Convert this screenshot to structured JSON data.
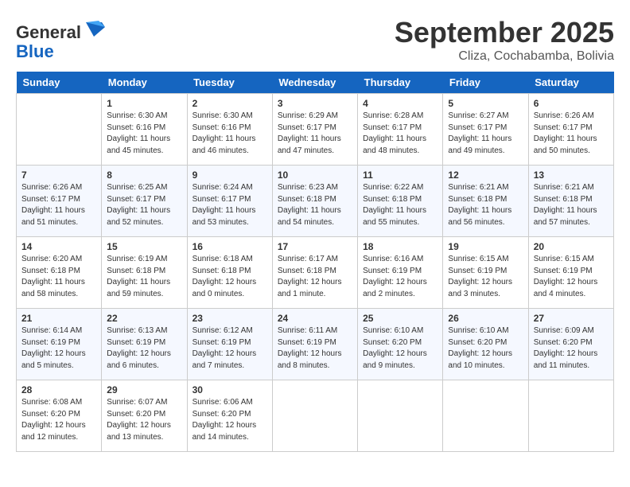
{
  "header": {
    "logo_general": "General",
    "logo_blue": "Blue",
    "month": "September 2025",
    "location": "Cliza, Cochabamba, Bolivia"
  },
  "columns": [
    "Sunday",
    "Monday",
    "Tuesday",
    "Wednesday",
    "Thursday",
    "Friday",
    "Saturday"
  ],
  "weeks": [
    [
      {
        "day": "",
        "info": ""
      },
      {
        "day": "1",
        "info": "Sunrise: 6:30 AM\nSunset: 6:16 PM\nDaylight: 11 hours\nand 45 minutes."
      },
      {
        "day": "2",
        "info": "Sunrise: 6:30 AM\nSunset: 6:16 PM\nDaylight: 11 hours\nand 46 minutes."
      },
      {
        "day": "3",
        "info": "Sunrise: 6:29 AM\nSunset: 6:17 PM\nDaylight: 11 hours\nand 47 minutes."
      },
      {
        "day": "4",
        "info": "Sunrise: 6:28 AM\nSunset: 6:17 PM\nDaylight: 11 hours\nand 48 minutes."
      },
      {
        "day": "5",
        "info": "Sunrise: 6:27 AM\nSunset: 6:17 PM\nDaylight: 11 hours\nand 49 minutes."
      },
      {
        "day": "6",
        "info": "Sunrise: 6:26 AM\nSunset: 6:17 PM\nDaylight: 11 hours\nand 50 minutes."
      }
    ],
    [
      {
        "day": "7",
        "info": "Sunrise: 6:26 AM\nSunset: 6:17 PM\nDaylight: 11 hours\nand 51 minutes."
      },
      {
        "day": "8",
        "info": "Sunrise: 6:25 AM\nSunset: 6:17 PM\nDaylight: 11 hours\nand 52 minutes."
      },
      {
        "day": "9",
        "info": "Sunrise: 6:24 AM\nSunset: 6:17 PM\nDaylight: 11 hours\nand 53 minutes."
      },
      {
        "day": "10",
        "info": "Sunrise: 6:23 AM\nSunset: 6:18 PM\nDaylight: 11 hours\nand 54 minutes."
      },
      {
        "day": "11",
        "info": "Sunrise: 6:22 AM\nSunset: 6:18 PM\nDaylight: 11 hours\nand 55 minutes."
      },
      {
        "day": "12",
        "info": "Sunrise: 6:21 AM\nSunset: 6:18 PM\nDaylight: 11 hours\nand 56 minutes."
      },
      {
        "day": "13",
        "info": "Sunrise: 6:21 AM\nSunset: 6:18 PM\nDaylight: 11 hours\nand 57 minutes."
      }
    ],
    [
      {
        "day": "14",
        "info": "Sunrise: 6:20 AM\nSunset: 6:18 PM\nDaylight: 11 hours\nand 58 minutes."
      },
      {
        "day": "15",
        "info": "Sunrise: 6:19 AM\nSunset: 6:18 PM\nDaylight: 11 hours\nand 59 minutes."
      },
      {
        "day": "16",
        "info": "Sunrise: 6:18 AM\nSunset: 6:18 PM\nDaylight: 12 hours\nand 0 minutes."
      },
      {
        "day": "17",
        "info": "Sunrise: 6:17 AM\nSunset: 6:18 PM\nDaylight: 12 hours\nand 1 minute."
      },
      {
        "day": "18",
        "info": "Sunrise: 6:16 AM\nSunset: 6:19 PM\nDaylight: 12 hours\nand 2 minutes."
      },
      {
        "day": "19",
        "info": "Sunrise: 6:15 AM\nSunset: 6:19 PM\nDaylight: 12 hours\nand 3 minutes."
      },
      {
        "day": "20",
        "info": "Sunrise: 6:15 AM\nSunset: 6:19 PM\nDaylight: 12 hours\nand 4 minutes."
      }
    ],
    [
      {
        "day": "21",
        "info": "Sunrise: 6:14 AM\nSunset: 6:19 PM\nDaylight: 12 hours\nand 5 minutes."
      },
      {
        "day": "22",
        "info": "Sunrise: 6:13 AM\nSunset: 6:19 PM\nDaylight: 12 hours\nand 6 minutes."
      },
      {
        "day": "23",
        "info": "Sunrise: 6:12 AM\nSunset: 6:19 PM\nDaylight: 12 hours\nand 7 minutes."
      },
      {
        "day": "24",
        "info": "Sunrise: 6:11 AM\nSunset: 6:19 PM\nDaylight: 12 hours\nand 8 minutes."
      },
      {
        "day": "25",
        "info": "Sunrise: 6:10 AM\nSunset: 6:20 PM\nDaylight: 12 hours\nand 9 minutes."
      },
      {
        "day": "26",
        "info": "Sunrise: 6:10 AM\nSunset: 6:20 PM\nDaylight: 12 hours\nand 10 minutes."
      },
      {
        "day": "27",
        "info": "Sunrise: 6:09 AM\nSunset: 6:20 PM\nDaylight: 12 hours\nand 11 minutes."
      }
    ],
    [
      {
        "day": "28",
        "info": "Sunrise: 6:08 AM\nSunset: 6:20 PM\nDaylight: 12 hours\nand 12 minutes."
      },
      {
        "day": "29",
        "info": "Sunrise: 6:07 AM\nSunset: 6:20 PM\nDaylight: 12 hours\nand 13 minutes."
      },
      {
        "day": "30",
        "info": "Sunrise: 6:06 AM\nSunset: 6:20 PM\nDaylight: 12 hours\nand 14 minutes."
      },
      {
        "day": "",
        "info": ""
      },
      {
        "day": "",
        "info": ""
      },
      {
        "day": "",
        "info": ""
      },
      {
        "day": "",
        "info": ""
      }
    ]
  ]
}
